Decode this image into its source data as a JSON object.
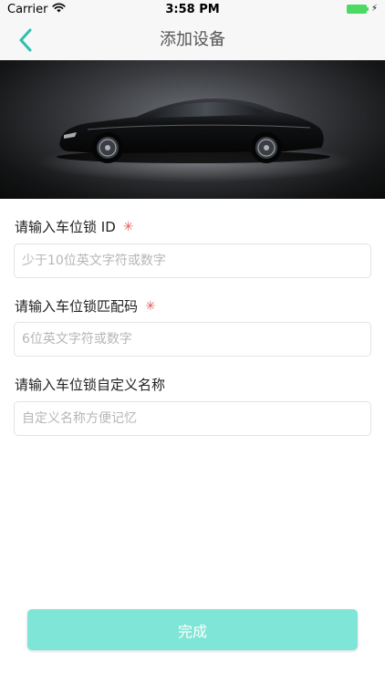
{
  "status_bar": {
    "carrier": "Carrier",
    "time": "3:58 PM",
    "battery_color": "#4cd964"
  },
  "nav": {
    "title": "添加设备",
    "back_icon": "chevron-left-icon",
    "accent_color": "#2ebfb0"
  },
  "hero": {
    "image": "black-sports-car-photo"
  },
  "form": {
    "fields": [
      {
        "label": "请输入车位锁 ID",
        "required_mark": "✳",
        "placeholder": "少于10位英文字符或数字",
        "value": ""
      },
      {
        "label": "请输入车位锁匹配码",
        "required_mark": "✳",
        "placeholder": "6位英文字符或数字",
        "value": ""
      },
      {
        "label": "请输入车位锁自定义名称",
        "placeholder": "自定义名称方便记忆",
        "value": ""
      }
    ]
  },
  "done_button": {
    "label": "完成",
    "color": "#7fe5d6"
  }
}
